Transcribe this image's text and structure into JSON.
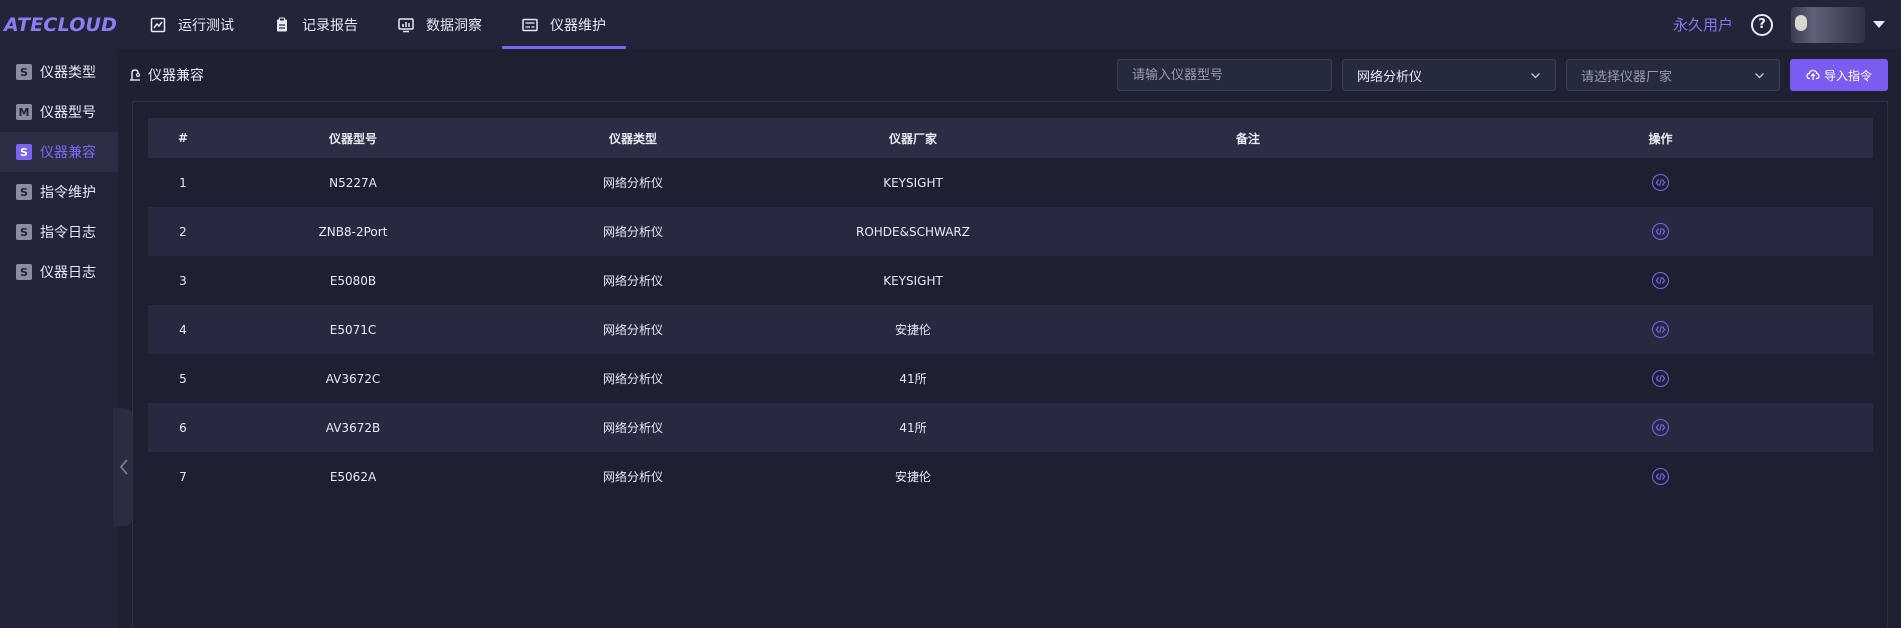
{
  "app": {
    "logo": "ATECLOUD"
  },
  "topnav": {
    "items": [
      {
        "label": "运行测试",
        "icon": "chart-icon"
      },
      {
        "label": "记录报告",
        "icon": "clipboard-icon"
      },
      {
        "label": "数据洞察",
        "icon": "monitor-chart-icon"
      },
      {
        "label": "仪器维护",
        "icon": "instrument-icon"
      }
    ],
    "active_index": 3
  },
  "user": {
    "name": "永久用户",
    "help_symbol": "?"
  },
  "sidebar": {
    "items": [
      {
        "badge": "S",
        "label": "仪器类型"
      },
      {
        "badge": "M",
        "label": "仪器型号"
      },
      {
        "badge": "S",
        "label": "仪器兼容"
      },
      {
        "badge": "S",
        "label": "指令维护"
      },
      {
        "badge": "S",
        "label": "指令日志"
      },
      {
        "badge": "S",
        "label": "仪器日志"
      }
    ],
    "active_index": 2
  },
  "page": {
    "title": "仪器兼容"
  },
  "filters": {
    "model_input": {
      "value": "",
      "placeholder": "请输入仪器型号"
    },
    "type_select": {
      "value": "网络分析仪"
    },
    "vendor_select": {
      "value": "请选择仪器厂家"
    },
    "import_label": "导入指令"
  },
  "table": {
    "columns": [
      "#",
      "仪器型号",
      "仪器类型",
      "仪器厂家",
      "备注",
      "操作"
    ],
    "rows": [
      [
        "1",
        "N5227A",
        "网络分析仪",
        "KEYSIGHT",
        ""
      ],
      [
        "2",
        "ZNB8-2Port",
        "网络分析仪",
        "ROHDE&SCHWARZ",
        ""
      ],
      [
        "3",
        "E5080B",
        "网络分析仪",
        "KEYSIGHT",
        ""
      ],
      [
        "4",
        "E5071C",
        "网络分析仪",
        "安捷伦",
        ""
      ],
      [
        "5",
        "AV3672C",
        "网络分析仪",
        "41所",
        ""
      ],
      [
        "6",
        "AV3672B",
        "网络分析仪",
        "41所",
        ""
      ],
      [
        "7",
        "E5062A",
        "网络分析仪",
        "安捷伦",
        ""
      ]
    ]
  },
  "colors": {
    "accent": "#7b64ef",
    "background": "#1f2133",
    "bar": "#22253a"
  }
}
